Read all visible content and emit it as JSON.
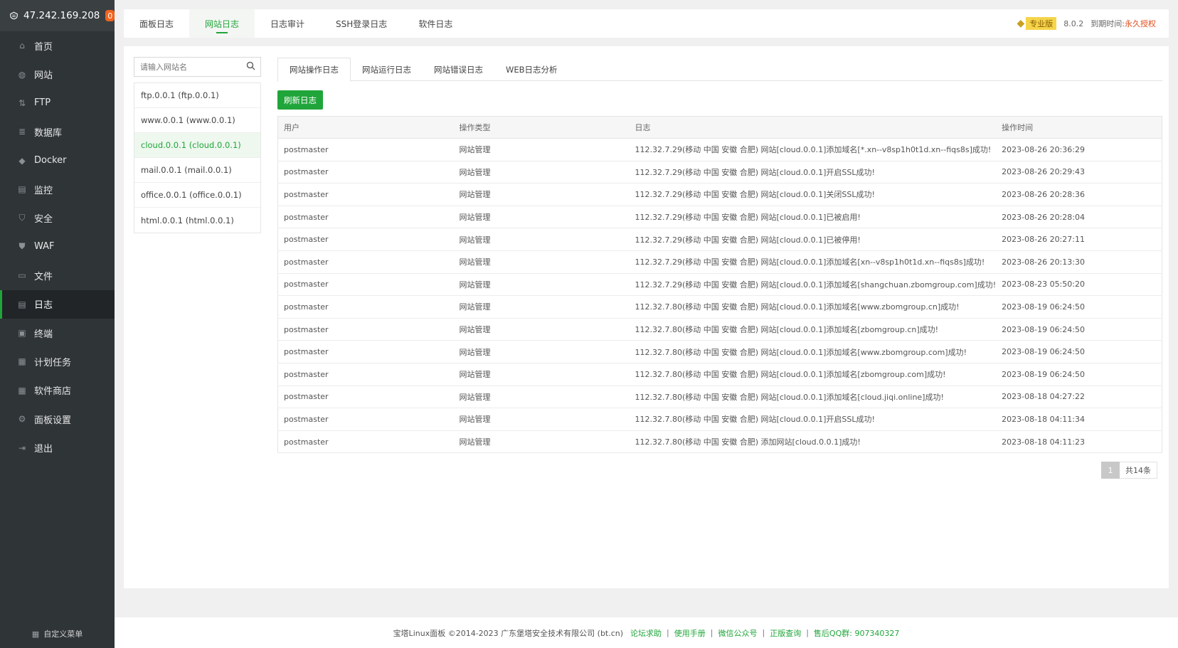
{
  "header": {
    "ip": "47.242.169.208",
    "notify_count": "0"
  },
  "sidebar": {
    "items": [
      {
        "label": "首页",
        "icon": "home-icon"
      },
      {
        "label": "网站",
        "icon": "globe-icon"
      },
      {
        "label": "FTP",
        "icon": "ftp-icon"
      },
      {
        "label": "数据库",
        "icon": "database-icon"
      },
      {
        "label": "Docker",
        "icon": "docker-icon"
      },
      {
        "label": "监控",
        "icon": "monitor-icon"
      },
      {
        "label": "安全",
        "icon": "shield-icon"
      },
      {
        "label": "WAF",
        "icon": "waf-icon"
      },
      {
        "label": "文件",
        "icon": "folder-icon"
      },
      {
        "label": "日志",
        "icon": "log-icon",
        "active": true
      },
      {
        "label": "终端",
        "icon": "terminal-icon"
      },
      {
        "label": "计划任务",
        "icon": "calendar-icon"
      },
      {
        "label": "软件商店",
        "icon": "apps-icon"
      },
      {
        "label": "面板设置",
        "icon": "gear-icon"
      },
      {
        "label": "退出",
        "icon": "logout-icon"
      }
    ],
    "footer_label": "自定义菜单"
  },
  "top_tabs": [
    "面板日志",
    "网站日志",
    "日志审计",
    "SSH登录日志",
    "软件日志"
  ],
  "top_right": {
    "pro_label": "专业版",
    "version": "8.0.2",
    "expire_label": "到期时间:",
    "expire_value": "永久授权"
  },
  "site_search": {
    "placeholder": "请输入网站名"
  },
  "sites": [
    "ftp.0.0.1 (ftp.0.0.1)",
    "www.0.0.1 (www.0.0.1)",
    "cloud.0.0.1 (cloud.0.0.1)",
    "mail.0.0.1 (mail.0.0.1)",
    "office.0.0.1 (office.0.0.1)",
    "html.0.0.1 (html.0.0.1)"
  ],
  "sub_tabs": [
    "网站操作日志",
    "网站运行日志",
    "网站错误日志",
    "WEB日志分析"
  ],
  "refresh_label": "刷新日志",
  "table": {
    "headers": [
      "用户",
      "操作类型",
      "日志",
      "操作时间"
    ],
    "rows": [
      [
        "postmaster",
        "网站管理",
        "112.32.7.29(移动 中国 安徽 合肥) 网站[cloud.0.0.1]添加域名[*.xn--v8sp1h0t1d.xn--fiqs8s]成功!",
        "2023-08-26 20:36:29"
      ],
      [
        "postmaster",
        "网站管理",
        "112.32.7.29(移动 中国 安徽 合肥) 网站[cloud.0.0.1]开启SSL成功!",
        "2023-08-26 20:29:43"
      ],
      [
        "postmaster",
        "网站管理",
        "112.32.7.29(移动 中国 安徽 合肥) 网站[cloud.0.0.1]关闭SSL成功!",
        "2023-08-26 20:28:36"
      ],
      [
        "postmaster",
        "网站管理",
        "112.32.7.29(移动 中国 安徽 合肥) 网站[cloud.0.0.1]已被启用!",
        "2023-08-26 20:28:04"
      ],
      [
        "postmaster",
        "网站管理",
        "112.32.7.29(移动 中国 安徽 合肥) 网站[cloud.0.0.1]已被停用!",
        "2023-08-26 20:27:11"
      ],
      [
        "postmaster",
        "网站管理",
        "112.32.7.29(移动 中国 安徽 合肥) 网站[cloud.0.0.1]添加域名[xn--v8sp1h0t1d.xn--fiqs8s]成功!",
        "2023-08-26 20:13:30"
      ],
      [
        "postmaster",
        "网站管理",
        "112.32.7.29(移动 中国 安徽 合肥) 网站[cloud.0.0.1]添加域名[shangchuan.zbomgroup.com]成功!",
        "2023-08-23 05:50:20"
      ],
      [
        "postmaster",
        "网站管理",
        "112.32.7.80(移动 中国 安徽 合肥) 网站[cloud.0.0.1]添加域名[www.zbomgroup.cn]成功!",
        "2023-08-19 06:24:50"
      ],
      [
        "postmaster",
        "网站管理",
        "112.32.7.80(移动 中国 安徽 合肥) 网站[cloud.0.0.1]添加域名[zbomgroup.cn]成功!",
        "2023-08-19 06:24:50"
      ],
      [
        "postmaster",
        "网站管理",
        "112.32.7.80(移动 中国 安徽 合肥) 网站[cloud.0.0.1]添加域名[www.zbomgroup.com]成功!",
        "2023-08-19 06:24:50"
      ],
      [
        "postmaster",
        "网站管理",
        "112.32.7.80(移动 中国 安徽 合肥) 网站[cloud.0.0.1]添加域名[zbomgroup.com]成功!",
        "2023-08-19 06:24:50"
      ],
      [
        "postmaster",
        "网站管理",
        "112.32.7.80(移动 中国 安徽 合肥) 网站[cloud.0.0.1]添加域名[cloud.jiqi.online]成功!",
        "2023-08-18 04:27:22"
      ],
      [
        "postmaster",
        "网站管理",
        "112.32.7.80(移动 中国 安徽 合肥) 网站[cloud.0.0.1]开启SSL成功!",
        "2023-08-18 04:11:34"
      ],
      [
        "postmaster",
        "网站管理",
        "112.32.7.80(移动 中国 安徽 合肥) 添加网站[cloud.0.0.1]成功!",
        "2023-08-18 04:11:23"
      ]
    ]
  },
  "pagination": {
    "current": "1",
    "total": "共14条"
  },
  "footer": {
    "copyright": "宝塔Linux面板 ©2014-2023 广东堡塔安全技术有限公司 (bt.cn)",
    "links": [
      "论坛求助",
      "使用手册",
      "微信公众号",
      "正版查询",
      "售后QQ群: 907340327"
    ]
  },
  "colors": {
    "accent": "#20a53a",
    "sidebar_bg": "#2f3437",
    "expire": "#e04b1a",
    "badge": "#f0641e"
  }
}
